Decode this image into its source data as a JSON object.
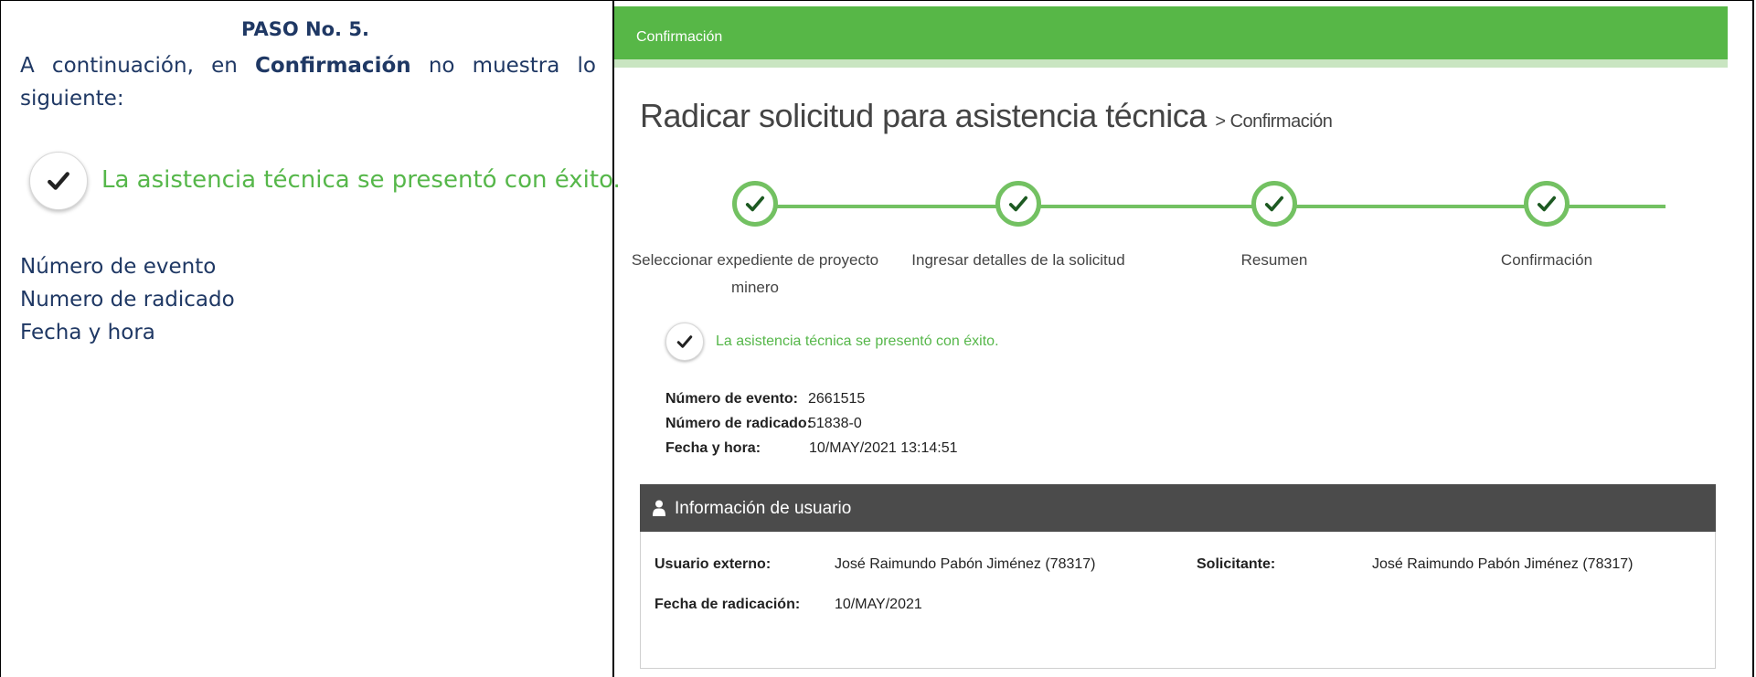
{
  "instructions": {
    "step_title": "PASO No. 5.",
    "intro_prefix": "A continuación, en ",
    "intro_bold": "Confirmación",
    "intro_suffix": " no muestra lo siguiente:",
    "example_message": "La asistencia técnica se presentó con éxito.",
    "fields": [
      "Número de evento",
      "Numero de radicado",
      "Fecha y hora"
    ]
  },
  "app": {
    "header_label": "Confirmación",
    "page_title": "Radicar solicitud para asistencia técnica",
    "breadcrumb": "> Confirmación",
    "steps": [
      {
        "label_line1": "Seleccionar expediente de proyecto",
        "label_line2": "minero"
      },
      {
        "label_line1": "Ingresar detalles de la solicitud",
        "label_line2": ""
      },
      {
        "label_line1": "Resumen",
        "label_line2": ""
      },
      {
        "label_line1": "Confirmación",
        "label_line2": ""
      }
    ],
    "success_message": "La asistencia técnica se presentó con éxito.",
    "details": {
      "event_label": "Número de evento:",
      "event_value": "2661515",
      "filing_label": "Número de radicado:",
      "filing_value": "51838-0",
      "datetime_label": "Fecha y hora:",
      "datetime_value": "10/MAY/2021 13:14:51"
    },
    "user_panel": {
      "title": "Información de usuario",
      "external_user_label": "Usuario externo:",
      "external_user_value": "José Raimundo Pabón Jiménez (78317)",
      "applicant_label": "Solicitante:",
      "applicant_value": "José Raimundo Pabón Jiménez (78317)",
      "filing_date_label": "Fecha de radicación:",
      "filing_date_value": "10/MAY/2021"
    },
    "colors": {
      "accent_green": "#57b747",
      "step_green": "#73c162",
      "message_green": "#56b74a",
      "panel_header": "#4b4b4b",
      "check_dark": "#1d5a22"
    },
    "icons": [
      "check-icon",
      "user-icon"
    ]
  }
}
